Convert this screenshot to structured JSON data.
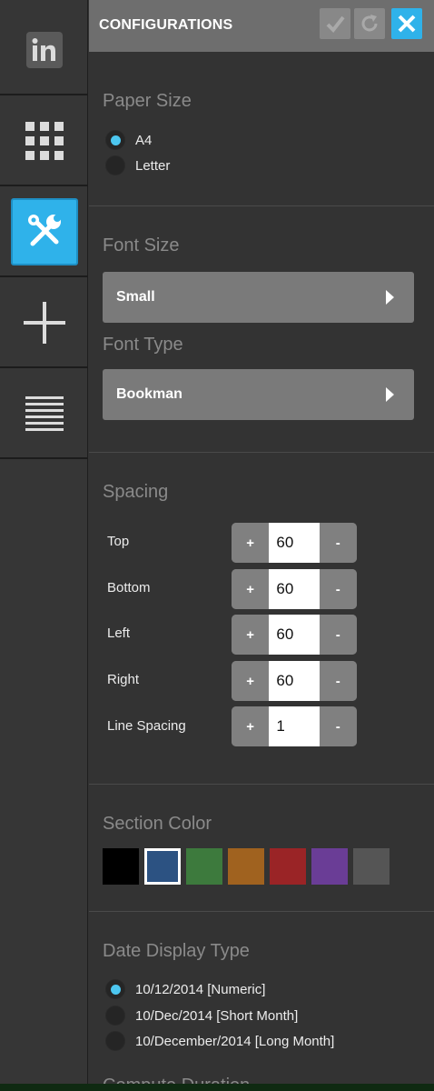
{
  "header": {
    "title": "CONFIGURATIONS"
  },
  "rail": {
    "items": [
      "linkedin-icon",
      "grid-icon",
      "tools-icon",
      "plus-icon",
      "lines-icon"
    ],
    "active_index": 2
  },
  "paper_size": {
    "title": "Paper Size",
    "options": [
      "A4",
      "Letter"
    ],
    "selected": "A4"
  },
  "font_size": {
    "title": "Font Size",
    "value": "Small"
  },
  "font_type": {
    "title": "Font Type",
    "value": "Bookman"
  },
  "spacing": {
    "title": "Spacing",
    "rows": [
      {
        "label": "Top",
        "value": "60"
      },
      {
        "label": "Bottom",
        "value": "60"
      },
      {
        "label": "Left",
        "value": "60"
      },
      {
        "label": "Right",
        "value": "60"
      },
      {
        "label": "Line Spacing",
        "value": "1"
      }
    ],
    "plus": "+",
    "minus": "-"
  },
  "section_color": {
    "title": "Section Color",
    "colors": [
      "#000000",
      "#2c5282",
      "#3d7a3d",
      "#a0621f",
      "#9a2426",
      "#6a3d96",
      "#555555"
    ],
    "selected_index": 1
  },
  "date_display": {
    "title": "Date Display Type",
    "options": [
      "10/12/2014 [Numeric]",
      "10/Dec/2014 [Short Month]",
      "10/December/2014 [Long Month]"
    ],
    "selected": "10/12/2014 [Numeric]"
  },
  "compute_duration": {
    "title": "Compute Duration"
  },
  "colors": {
    "accent": "#2fb2ea",
    "rail_bg": "#363636",
    "header_bg": "#6e6e6e",
    "panel_bg": "#333333",
    "select_bg": "#7a7a7a"
  }
}
